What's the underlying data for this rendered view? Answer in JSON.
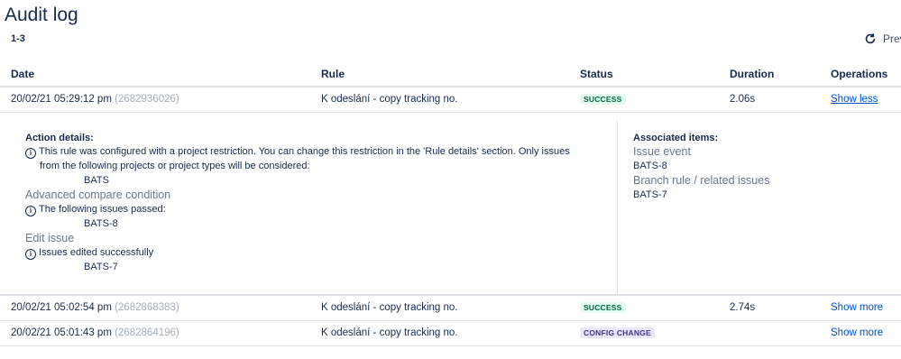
{
  "page": {
    "title": "Audit log",
    "range": "1-3",
    "prev_label": "Prev"
  },
  "columns": [
    "Date",
    "Rule",
    "Status",
    "Duration",
    "Operations"
  ],
  "rows": [
    {
      "date": "20/02/21 05:29:12 pm",
      "id": "(2682936026)",
      "rule": "K odeslání - copy tracking no.",
      "status": "SUCCESS",
      "duration": "2.06s",
      "operation": "Show less"
    },
    {
      "date": "20/02/21 05:02:54 pm",
      "id": "(2682868383)",
      "rule": "K odeslání - copy tracking no.",
      "status": "SUCCESS",
      "duration": "2.74s",
      "operation": "Show more"
    },
    {
      "date": "20/02/21 05:01:43 pm",
      "id": "(2682864196)",
      "rule": "K odeslání - copy tracking no.",
      "status": "CONFIG CHANGE",
      "duration": "",
      "operation": "Show more"
    }
  ],
  "details": {
    "action_title": "Action details:",
    "restriction_line1": "This rule was configured with a project restriction. You can change this restriction in the 'Rule details' section. Only issues",
    "restriction_line2": "from the following projects or project types will be considered:",
    "restriction_project": "BATS",
    "compare_title": "Advanced compare condition",
    "compare_text": "The following issues passed:",
    "compare_issue": "BATS-8",
    "edit_title": "Edit issue",
    "edit_text": "Issues edited successfully",
    "edit_issue": "BATS-7",
    "associated_title": "Associated items:",
    "issue_event_label": "Issue event",
    "issue_event_item": "BATS-8",
    "branch_label": "Branch rule / related issues",
    "branch_item": "BATS-7"
  },
  "colors": {
    "success_bg": "#e3fcef",
    "config_bg": "#eae6ff",
    "link": "#0052cc"
  },
  "icons": {
    "refresh": "refresh-icon",
    "info": "info-icon"
  }
}
